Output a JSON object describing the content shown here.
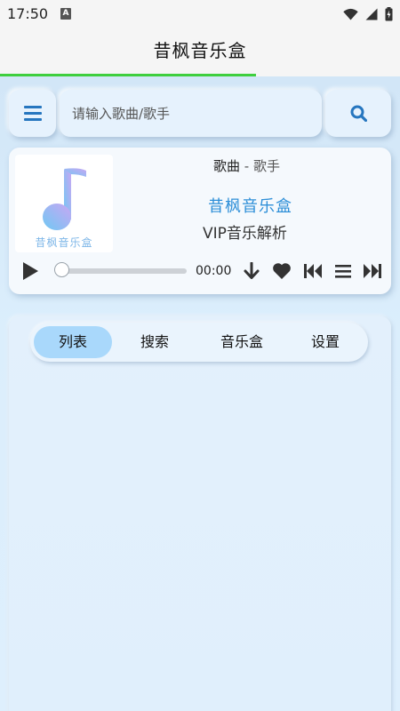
{
  "status": {
    "time": "17:50"
  },
  "appbar": {
    "title": "昔枫音乐盒",
    "load_progress": 0.64
  },
  "search": {
    "placeholder": "请输入歌曲/歌手"
  },
  "player": {
    "song": "歌曲",
    "separator": " - ",
    "artist": "歌手",
    "app_name": "昔枫音乐盒",
    "subtitle": "VIP音乐解析",
    "cover_text": "昔枫音乐盒",
    "time": "00:00",
    "progress": 0
  },
  "tabs": [
    {
      "label": "列表",
      "active": true
    },
    {
      "label": "搜索",
      "active": false
    },
    {
      "label": "音乐盒",
      "active": false
    },
    {
      "label": "设置",
      "active": false
    }
  ],
  "colors": {
    "accent": "#2e8fd8",
    "active_tab": "#a9d8fb",
    "load_bar": "#3ecf3e"
  }
}
